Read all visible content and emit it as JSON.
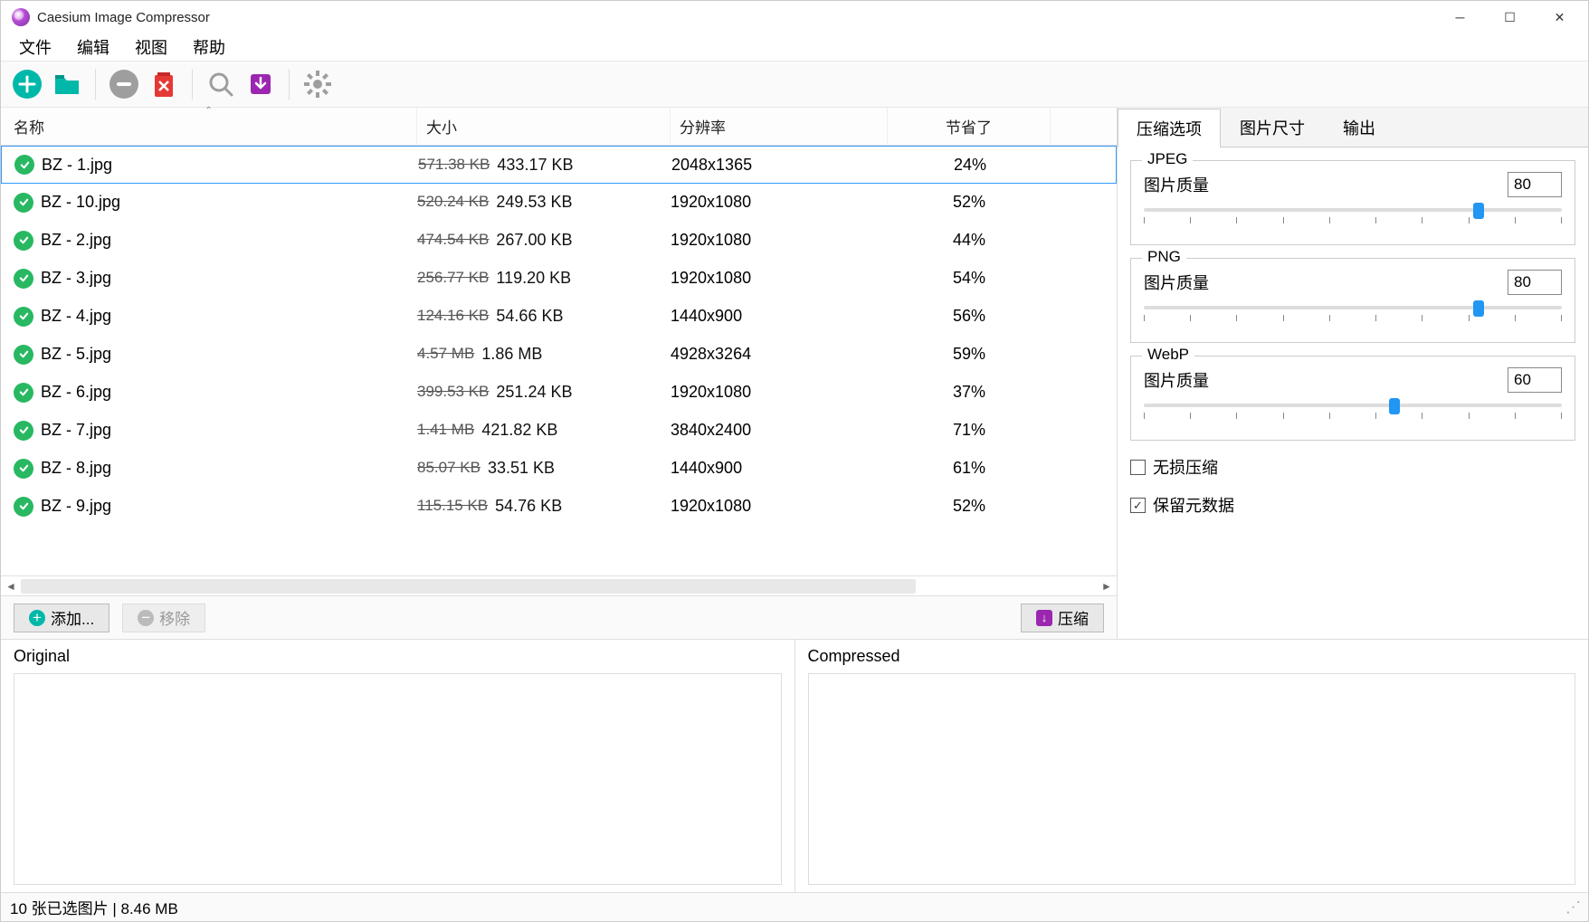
{
  "title": "Caesium Image Compressor",
  "menu": [
    "文件",
    "编辑",
    "视图",
    "帮助"
  ],
  "columns": {
    "name": "名称",
    "size": "大小",
    "res": "分辨率",
    "save": "节省了"
  },
  "rows": [
    {
      "n": "BZ - 1.jpg",
      "old": "571.38 KB",
      "new": "433.17 KB",
      "res": "2048x1365",
      "save": "24%",
      "sel": true
    },
    {
      "n": "BZ - 10.jpg",
      "old": "520.24 KB",
      "new": "249.53 KB",
      "res": "1920x1080",
      "save": "52%"
    },
    {
      "n": "BZ - 2.jpg",
      "old": "474.54 KB",
      "new": "267.00 KB",
      "res": "1920x1080",
      "save": "44%"
    },
    {
      "n": "BZ - 3.jpg",
      "old": "256.77 KB",
      "new": "119.20 KB",
      "res": "1920x1080",
      "save": "54%"
    },
    {
      "n": "BZ - 4.jpg",
      "old": "124.16 KB",
      "new": "54.66 KB",
      "res": "1440x900",
      "save": "56%"
    },
    {
      "n": "BZ - 5.jpg",
      "old": "4.57 MB",
      "new": "1.86 MB",
      "res": "4928x3264",
      "save": "59%"
    },
    {
      "n": "BZ - 6.jpg",
      "old": "399.53 KB",
      "new": "251.24 KB",
      "res": "1920x1080",
      "save": "37%"
    },
    {
      "n": "BZ - 7.jpg",
      "old": "1.41 MB",
      "new": "421.82 KB",
      "res": "3840x2400",
      "save": "71%"
    },
    {
      "n": "BZ - 8.jpg",
      "old": "85.07 KB",
      "new": "33.51 KB",
      "res": "1440x900",
      "save": "61%"
    },
    {
      "n": "BZ - 9.jpg",
      "old": "115.15 KB",
      "new": "54.76 KB",
      "res": "1920x1080",
      "save": "52%"
    }
  ],
  "buttons": {
    "add": "添加...",
    "remove": "移除",
    "compress": "压缩"
  },
  "tabs": {
    "t1": "压缩选项",
    "t2": "图片尺寸",
    "t3": "输出"
  },
  "panel": {
    "jpeg": {
      "legend": "JPEG",
      "label": "图片质量",
      "value": "80",
      "percent": 80
    },
    "png": {
      "legend": "PNG",
      "label": "图片质量",
      "value": "80",
      "percent": 80
    },
    "webp": {
      "legend": "WebP",
      "label": "图片质量",
      "value": "60",
      "percent": 60
    },
    "lossless": "无损压缩",
    "meta": "保留元数据"
  },
  "preview": {
    "orig": "Original",
    "comp": "Compressed"
  },
  "status": "10 张已选图片 | 8.46 MB"
}
